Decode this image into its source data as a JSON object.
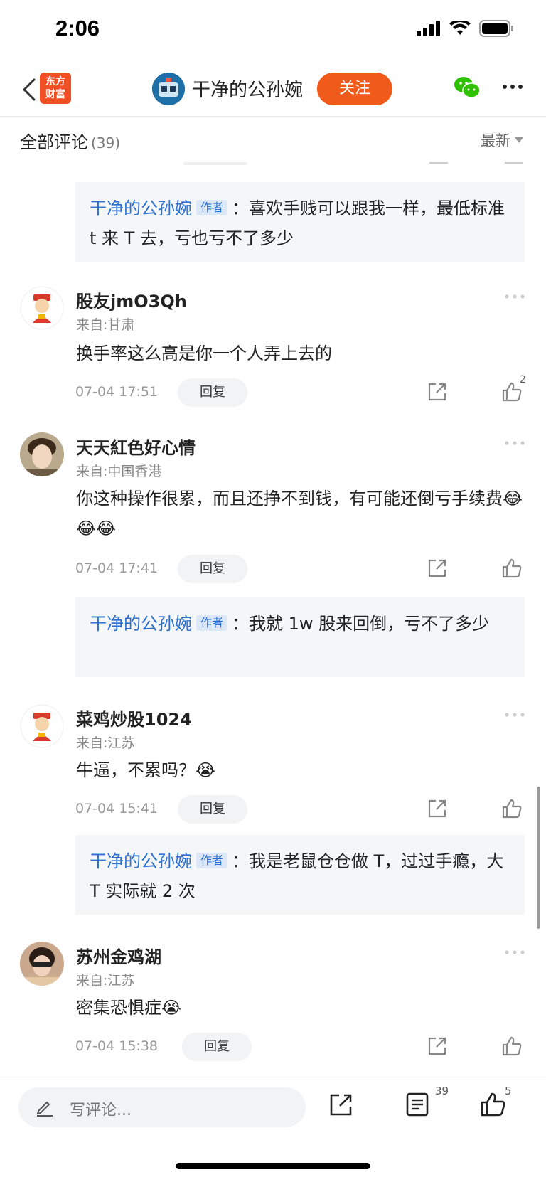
{
  "status_bar": {
    "time": "2:06"
  },
  "nav": {
    "brand_line1": "东方",
    "brand_line2": "财富",
    "author_name": "干净的公孙婉",
    "follow_label": "关注"
  },
  "comments_header": {
    "title": "全部评论",
    "count": "(39)",
    "sort_label": "最新"
  },
  "replies": [
    {
      "author": "干净的公孙婉",
      "tag": "作者",
      "text": "：喜欢手贱可以跟我一样，最低标准 t 来 T 去，亏也亏不了多少"
    },
    {
      "author": "干净的公孙婉",
      "tag": "作者",
      "text": "：我就 1w 股来回倒，亏不了多少"
    },
    {
      "author": "干净的公孙婉",
      "tag": "作者",
      "text": "：我是老鼠仓仓做 T，过过手瘾，大 T 实际就 2 次"
    }
  ],
  "comments": [
    {
      "name": "股友jmO3Qh",
      "location": "来自:甘肃",
      "text": "换手率这么高是你一个人弄上去的",
      "time": "07-04 17:51",
      "reply_label": "回复",
      "likes": "2"
    },
    {
      "name": "天天紅色好心情",
      "location": "来自:中国香港",
      "text": "你这种操作很累，而且还挣不到钱，有可能还倒亏手续费😂😂😂",
      "time": "07-04 17:41",
      "reply_label": "回复",
      "likes": ""
    },
    {
      "name": "菜鸡炒股1024",
      "location": "来自:江苏",
      "text": "牛逼，不累吗？😭",
      "time": "07-04 15:41",
      "reply_label": "回复",
      "likes": ""
    },
    {
      "name": "苏州金鸡湖",
      "location": "来自:江苏",
      "text": "密集恐惧症😭",
      "time": "07-04 15:38",
      "reply_label": "回复",
      "likes": ""
    }
  ],
  "bottom_bar": {
    "input_placeholder": "写评论...",
    "comment_count": "39",
    "like_count": "5"
  },
  "colors": {
    "accent": "#f05a1a",
    "link": "#2a6fd1",
    "brand": "#f04e23"
  }
}
